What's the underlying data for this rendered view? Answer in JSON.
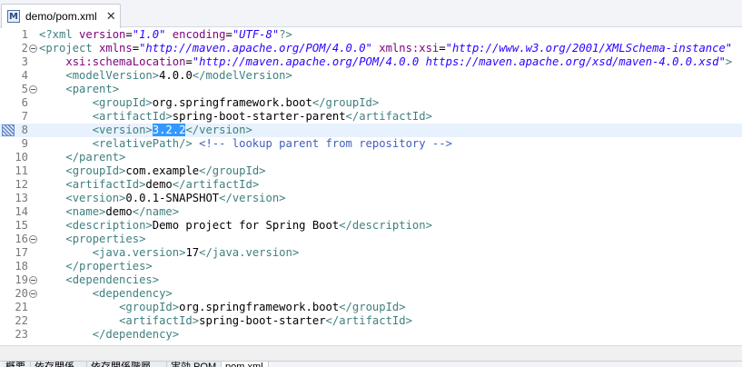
{
  "tab": {
    "icon": "M",
    "title": "demo/pom.xml",
    "close": "✕"
  },
  "editor": {
    "current_line": 8,
    "change_marker_line": 8,
    "lines": [
      {
        "n": 1,
        "fold": false,
        "tokens": [
          {
            "c": "tag",
            "t": "<?xml "
          },
          {
            "c": "attr",
            "t": "version"
          },
          {
            "c": "txt",
            "t": "="
          },
          {
            "c": "val",
            "t": "\"1.0\""
          },
          {
            "c": "txt",
            "t": " "
          },
          {
            "c": "attr",
            "t": "encoding"
          },
          {
            "c": "txt",
            "t": "="
          },
          {
            "c": "val",
            "t": "\"UTF-8\""
          },
          {
            "c": "tag",
            "t": "?>"
          }
        ]
      },
      {
        "n": 2,
        "fold": true,
        "tokens": [
          {
            "c": "tag",
            "t": "<project "
          },
          {
            "c": "attr",
            "t": "xmlns"
          },
          {
            "c": "txt",
            "t": "="
          },
          {
            "c": "val",
            "t": "\"http://maven.apache.org/POM/4.0.0\""
          },
          {
            "c": "txt",
            "t": " "
          },
          {
            "c": "attr",
            "t": "xmlns:xsi"
          },
          {
            "c": "txt",
            "t": "="
          },
          {
            "c": "val",
            "t": "\"http://www.w3.org/2001/XMLSchema-instance\""
          }
        ]
      },
      {
        "n": 3,
        "fold": false,
        "tokens": [
          {
            "c": "txt",
            "t": "    "
          },
          {
            "c": "attr",
            "t": "xsi:schemaLocation"
          },
          {
            "c": "txt",
            "t": "="
          },
          {
            "c": "val",
            "t": "\"http://maven.apache.org/POM/4.0.0 https://maven.apache.org/xsd/maven-4.0.0.xsd\""
          },
          {
            "c": "tag",
            "t": ">"
          }
        ]
      },
      {
        "n": 4,
        "fold": false,
        "tokens": [
          {
            "c": "txt",
            "t": "    "
          },
          {
            "c": "tag",
            "t": "<modelVersion>"
          },
          {
            "c": "txt",
            "t": "4.0.0"
          },
          {
            "c": "tag",
            "t": "</modelVersion>"
          }
        ]
      },
      {
        "n": 5,
        "fold": true,
        "tokens": [
          {
            "c": "txt",
            "t": "    "
          },
          {
            "c": "tag",
            "t": "<parent>"
          }
        ]
      },
      {
        "n": 6,
        "fold": false,
        "tokens": [
          {
            "c": "txt",
            "t": "        "
          },
          {
            "c": "tag",
            "t": "<groupId>"
          },
          {
            "c": "txt",
            "t": "org.springframework.boot"
          },
          {
            "c": "tag",
            "t": "</groupId>"
          }
        ]
      },
      {
        "n": 7,
        "fold": false,
        "tokens": [
          {
            "c": "txt",
            "t": "        "
          },
          {
            "c": "tag",
            "t": "<artifactId>"
          },
          {
            "c": "txt",
            "t": "spring-boot-starter-parent"
          },
          {
            "c": "tag",
            "t": "</artifactId>"
          }
        ]
      },
      {
        "n": 8,
        "fold": false,
        "tokens": [
          {
            "c": "txt",
            "t": "        "
          },
          {
            "c": "tag",
            "t": "<version>"
          },
          {
            "c": "sel",
            "t": "3.2.2"
          },
          {
            "c": "tag",
            "t": "</version>"
          }
        ]
      },
      {
        "n": 9,
        "fold": false,
        "tokens": [
          {
            "c": "txt",
            "t": "        "
          },
          {
            "c": "tag",
            "t": "<relativePath/>"
          },
          {
            "c": "txt",
            "t": " "
          },
          {
            "c": "comment",
            "t": "<!-- lookup parent from repository -->"
          }
        ]
      },
      {
        "n": 10,
        "fold": false,
        "tokens": [
          {
            "c": "txt",
            "t": "    "
          },
          {
            "c": "tag",
            "t": "</parent>"
          }
        ]
      },
      {
        "n": 11,
        "fold": false,
        "tokens": [
          {
            "c": "txt",
            "t": "    "
          },
          {
            "c": "tag",
            "t": "<groupId>"
          },
          {
            "c": "txt",
            "t": "com.example"
          },
          {
            "c": "tag",
            "t": "</groupId>"
          }
        ]
      },
      {
        "n": 12,
        "fold": false,
        "tokens": [
          {
            "c": "txt",
            "t": "    "
          },
          {
            "c": "tag",
            "t": "<artifactId>"
          },
          {
            "c": "txt",
            "t": "demo"
          },
          {
            "c": "tag",
            "t": "</artifactId>"
          }
        ]
      },
      {
        "n": 13,
        "fold": false,
        "tokens": [
          {
            "c": "txt",
            "t": "    "
          },
          {
            "c": "tag",
            "t": "<version>"
          },
          {
            "c": "txt",
            "t": "0.0.1-SNAPSHOT"
          },
          {
            "c": "tag",
            "t": "</version>"
          }
        ]
      },
      {
        "n": 14,
        "fold": false,
        "tokens": [
          {
            "c": "txt",
            "t": "    "
          },
          {
            "c": "tag",
            "t": "<name>"
          },
          {
            "c": "txt",
            "t": "demo"
          },
          {
            "c": "tag",
            "t": "</name>"
          }
        ]
      },
      {
        "n": 15,
        "fold": false,
        "tokens": [
          {
            "c": "txt",
            "t": "    "
          },
          {
            "c": "tag",
            "t": "<description>"
          },
          {
            "c": "txt",
            "t": "Demo project for Spring Boot"
          },
          {
            "c": "tag",
            "t": "</description>"
          }
        ]
      },
      {
        "n": 16,
        "fold": true,
        "tokens": [
          {
            "c": "txt",
            "t": "    "
          },
          {
            "c": "tag",
            "t": "<properties>"
          }
        ]
      },
      {
        "n": 17,
        "fold": false,
        "tokens": [
          {
            "c": "txt",
            "t": "        "
          },
          {
            "c": "tag",
            "t": "<java.version>"
          },
          {
            "c": "txt",
            "t": "17"
          },
          {
            "c": "tag",
            "t": "</java.version>"
          }
        ]
      },
      {
        "n": 18,
        "fold": false,
        "tokens": [
          {
            "c": "txt",
            "t": "    "
          },
          {
            "c": "tag",
            "t": "</properties>"
          }
        ]
      },
      {
        "n": 19,
        "fold": true,
        "tokens": [
          {
            "c": "txt",
            "t": "    "
          },
          {
            "c": "tag",
            "t": "<dependencies>"
          }
        ]
      },
      {
        "n": 20,
        "fold": true,
        "tokens": [
          {
            "c": "txt",
            "t": "        "
          },
          {
            "c": "tag",
            "t": "<dependency>"
          }
        ]
      },
      {
        "n": 21,
        "fold": false,
        "tokens": [
          {
            "c": "txt",
            "t": "            "
          },
          {
            "c": "tag",
            "t": "<groupId>"
          },
          {
            "c": "txt",
            "t": "org.springframework.boot"
          },
          {
            "c": "tag",
            "t": "</groupId>"
          }
        ]
      },
      {
        "n": 22,
        "fold": false,
        "tokens": [
          {
            "c": "txt",
            "t": "            "
          },
          {
            "c": "tag",
            "t": "<artifactId>"
          },
          {
            "c": "txt",
            "t": "spring-boot-starter"
          },
          {
            "c": "tag",
            "t": "</artifactId>"
          }
        ]
      },
      {
        "n": 23,
        "fold": false,
        "tokens": [
          {
            "c": "txt",
            "t": "        "
          },
          {
            "c": "tag",
            "t": "</dependency>"
          }
        ]
      }
    ]
  },
  "colors": {
    "tag": "#3f7f7f",
    "attr": "#7f007f",
    "value": "#2a00ff",
    "comment": "#3f5fbf",
    "selection": "#3399ff",
    "current_line": "#e8f2fe"
  },
  "bottom_tabs": [
    "概要",
    "依存関係",
    "依存関係階層",
    "実効 POM",
    "pom.xml"
  ]
}
